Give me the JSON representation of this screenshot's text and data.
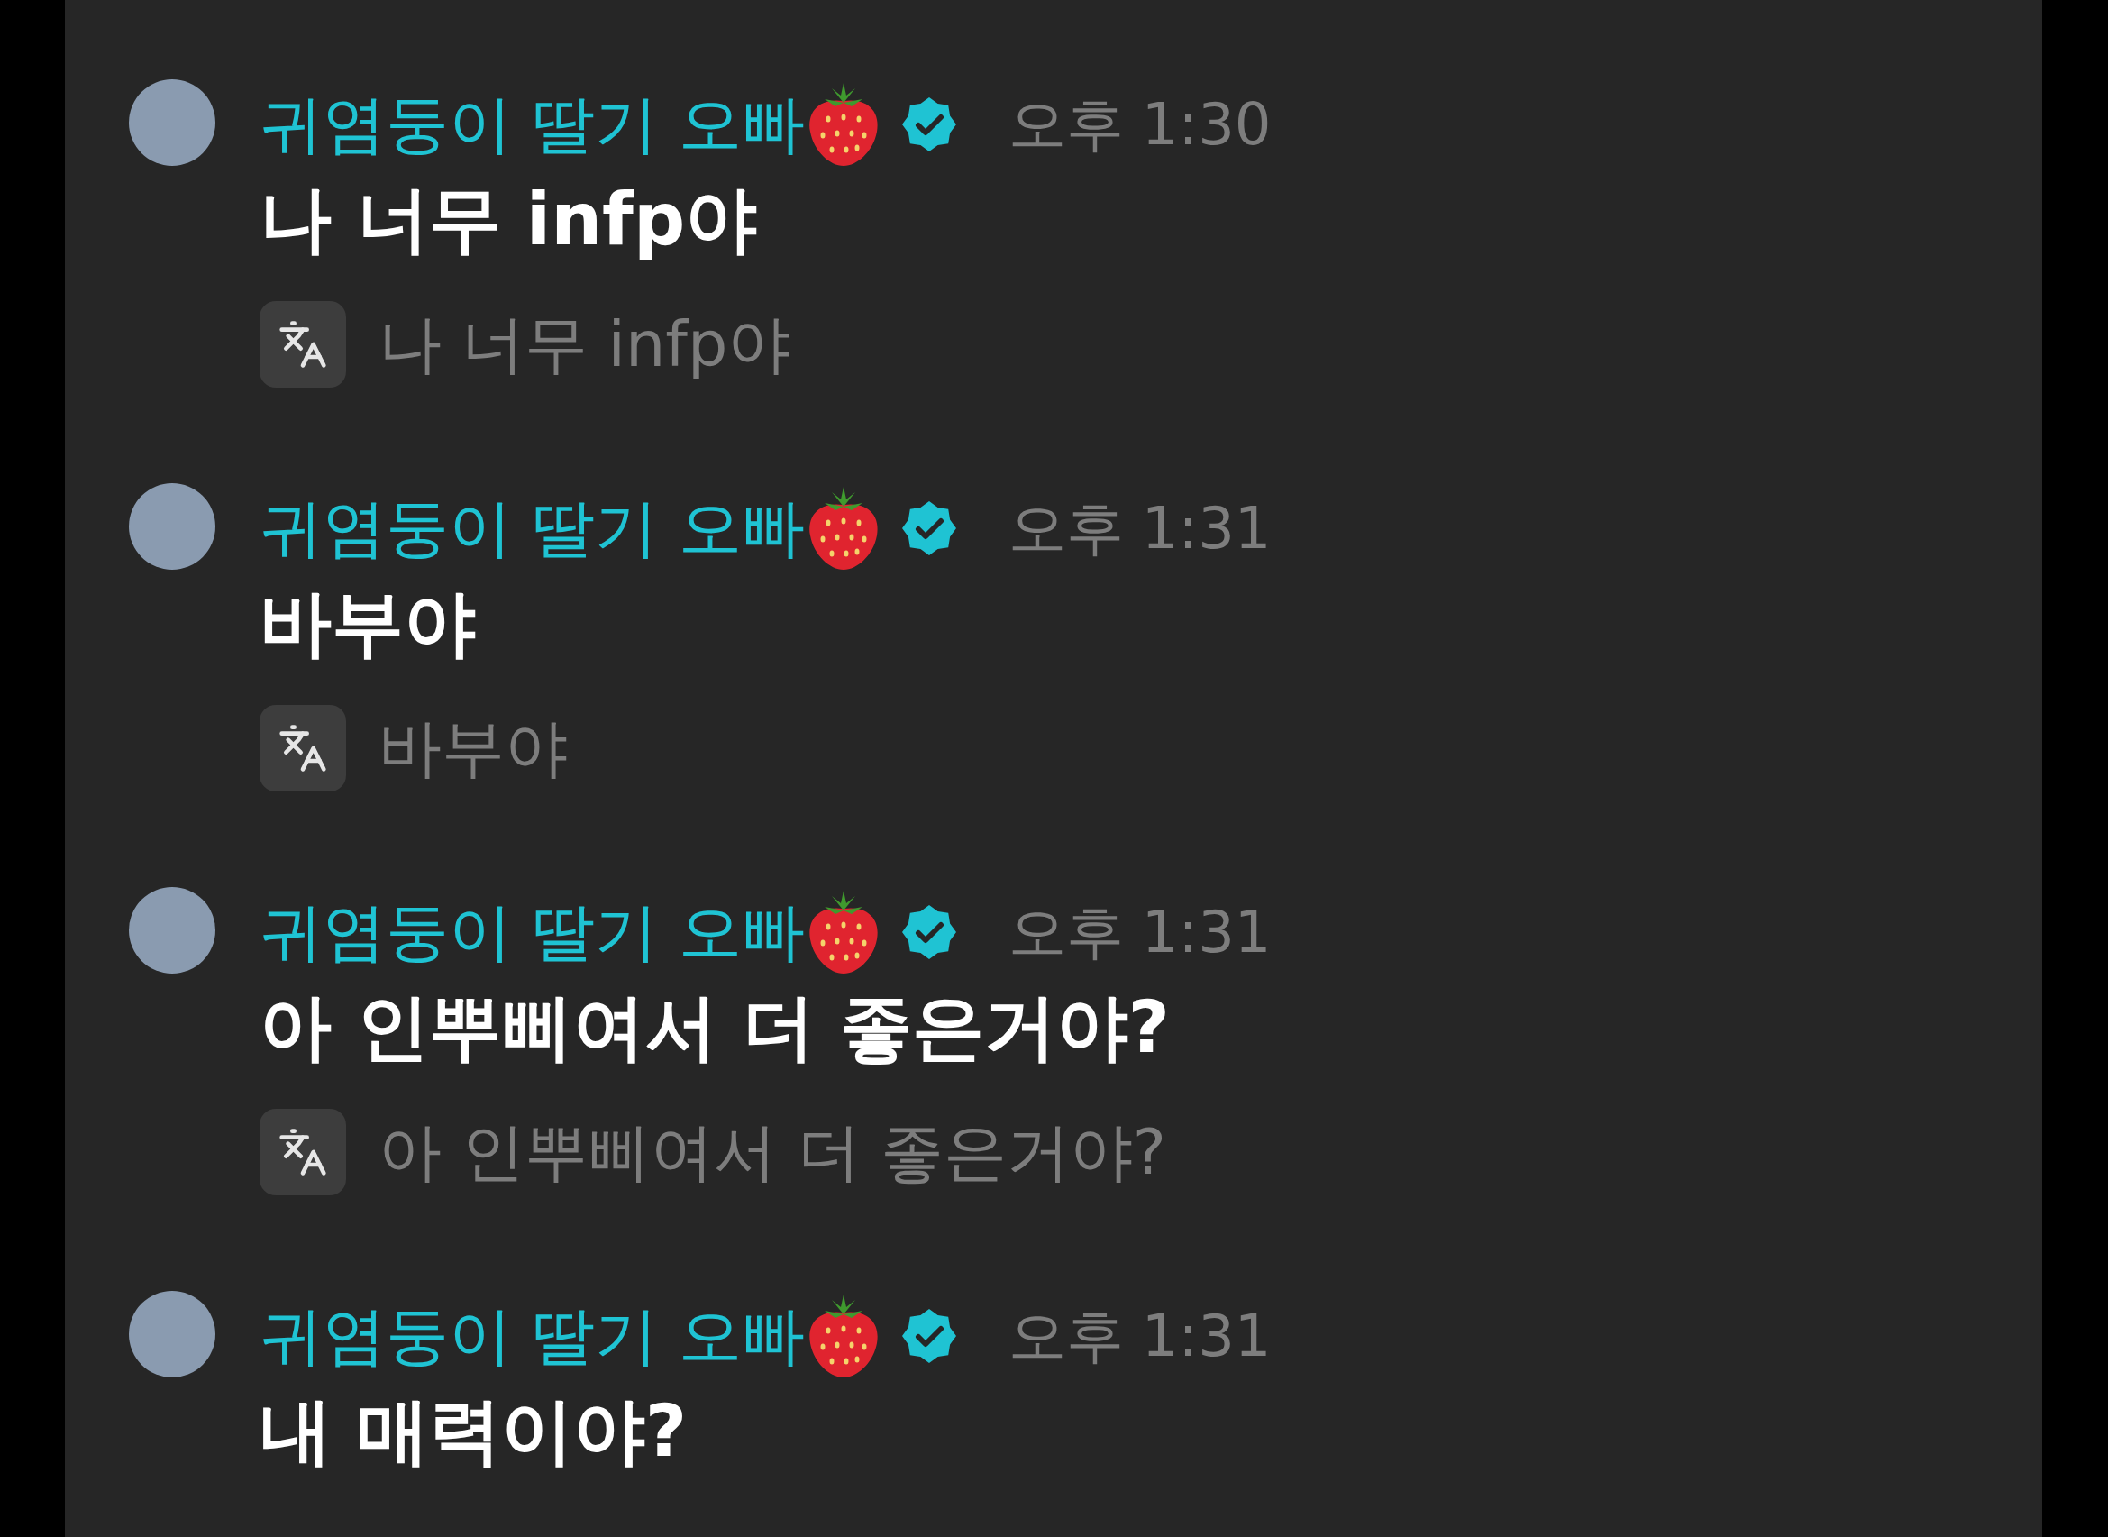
{
  "messages": [
    {
      "author": "귀염둥이 딸기 오빠",
      "verified": true,
      "time": "오후 1:30",
      "text": "나 너무 infp야",
      "translation": "나 너무 infp야"
    },
    {
      "author": "귀염둥이 딸기 오빠",
      "verified": true,
      "time": "오후 1:31",
      "text": "바부야",
      "translation": "바부야"
    },
    {
      "author": "귀염둥이 딸기 오빠",
      "verified": true,
      "time": "오후 1:31",
      "text": "아 인뿌삐여서 더 좋은거야?",
      "translation": "아 인뿌삐여서 더 좋은거야?"
    },
    {
      "author": "귀염둥이 딸기 오빠",
      "verified": true,
      "time": "오후 1:31",
      "text": "내 매력이야?"
    }
  ]
}
